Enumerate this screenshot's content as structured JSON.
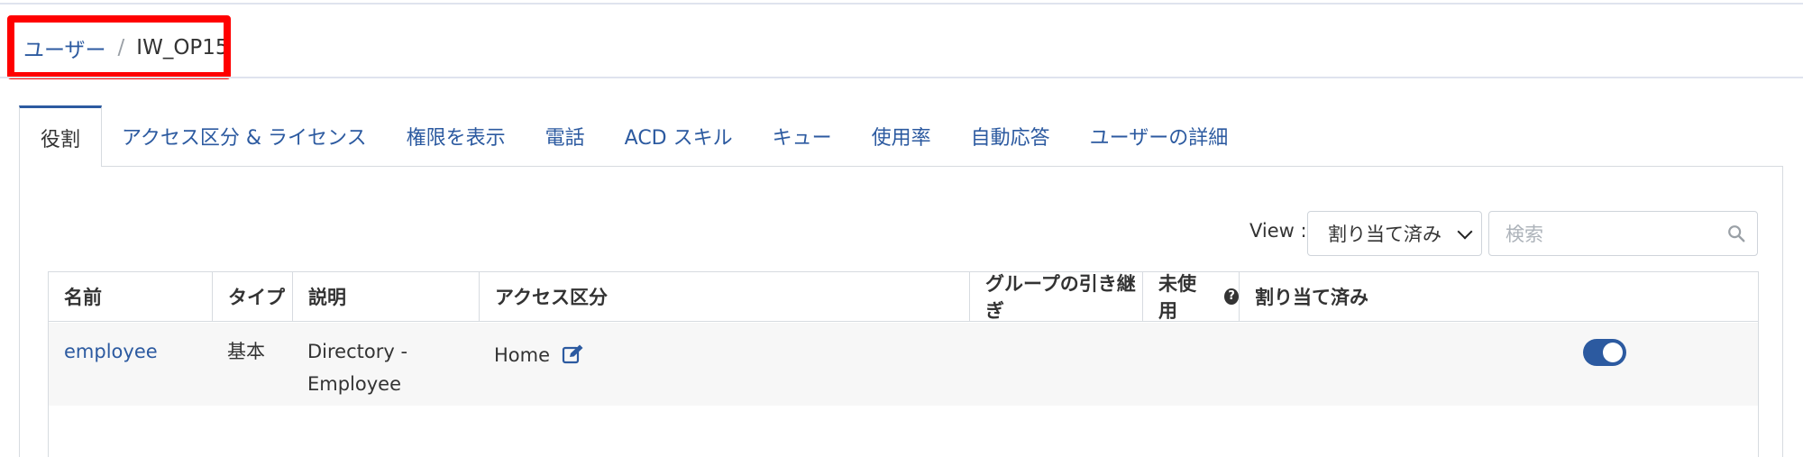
{
  "breadcrumb": {
    "parent": "ユーザー",
    "separator": "/",
    "current": "IW_OP15"
  },
  "tabs": [
    {
      "label": "役割",
      "active": true
    },
    {
      "label": "アクセス区分 & ライセンス"
    },
    {
      "label": "権限を表示"
    },
    {
      "label": "電話"
    },
    {
      "label": "ACD スキル"
    },
    {
      "label": "キュー"
    },
    {
      "label": "使用率"
    },
    {
      "label": "自動応答"
    },
    {
      "label": "ユーザーの詳細"
    }
  ],
  "filter": {
    "view_label": "View :",
    "view_value": "割り当て済み",
    "search_placeholder": "検索"
  },
  "table": {
    "columns": [
      "名前",
      "タイプ",
      "説明",
      "アクセス区分",
      "グループの引き継ぎ",
      "未使用",
      "割り当て済み"
    ],
    "rows": [
      {
        "name": "employee",
        "type": "基本",
        "description_line1": "Directory -",
        "description_line2": "Employee",
        "division": "Home",
        "group_inherit": "",
        "unused": "",
        "assigned": true
      }
    ]
  },
  "colors": {
    "accent": "#2c5aa0",
    "highlight": "#ff0000"
  }
}
